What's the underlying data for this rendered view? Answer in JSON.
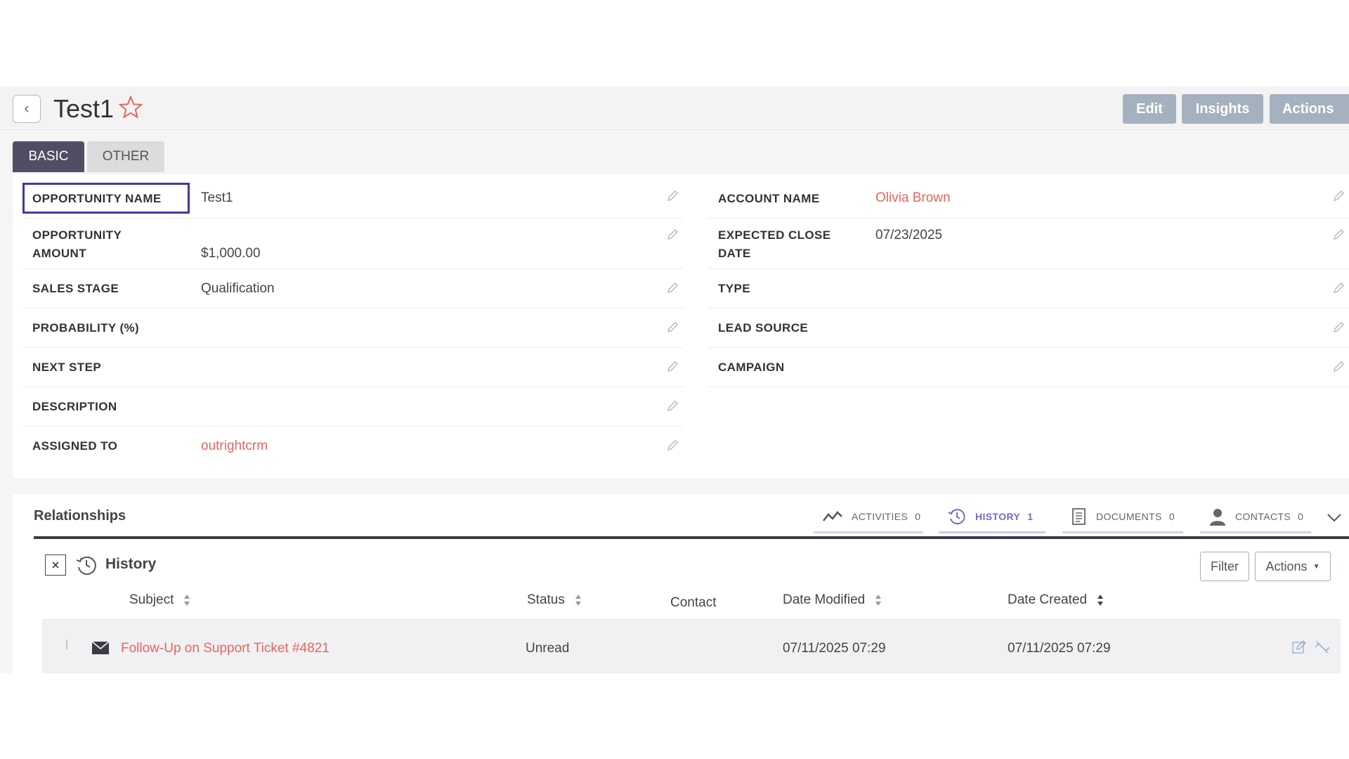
{
  "header": {
    "title": "Test1",
    "buttons": {
      "edit": "Edit",
      "insights": "Insights",
      "actions": "Actions"
    }
  },
  "tabs": [
    {
      "label": "BASIC",
      "active": true
    },
    {
      "label": "OTHER",
      "active": false
    }
  ],
  "fields_left": [
    {
      "label": "OPPORTUNITY NAME",
      "value": "Test1"
    },
    {
      "label_line1": "OPPORTUNITY",
      "label_line2": "AMOUNT",
      "value": "$1,000.00"
    },
    {
      "label": "SALES STAGE",
      "value": "Qualification"
    },
    {
      "label": "PROBABILITY (%)",
      "value": ""
    },
    {
      "label": "NEXT STEP",
      "value": ""
    },
    {
      "label": "DESCRIPTION",
      "value": ""
    },
    {
      "label": "ASSIGNED TO",
      "value": "outrightcrm"
    }
  ],
  "fields_right": [
    {
      "label": "ACCOUNT NAME",
      "value": "Olivia Brown"
    },
    {
      "label_line1": "EXPECTED CLOSE",
      "label_line2": "DATE",
      "value": "07/23/2025"
    },
    {
      "label": "TYPE",
      "value": ""
    },
    {
      "label": "LEAD SOURCE",
      "value": ""
    },
    {
      "label": "CAMPAIGN",
      "value": ""
    }
  ],
  "relationships": {
    "title": "Relationships",
    "tabs": [
      {
        "label": "ACTIVITIES",
        "count": "0",
        "icon": "activity-chart-icon"
      },
      {
        "label": "HISTORY",
        "count": "1",
        "icon": "history-clock-icon",
        "active": true
      },
      {
        "label": "DOCUMENTS",
        "count": "0",
        "icon": "document-icon"
      },
      {
        "label": "CONTACTS",
        "count": "0",
        "icon": "person-icon"
      }
    ],
    "subpanel": {
      "title": "History",
      "filter_label": "Filter",
      "actions_label": "Actions",
      "columns": [
        "Subject",
        "Status",
        "Contact",
        "Date Modified",
        "Date Created"
      ],
      "rows": [
        {
          "subject": "Follow-Up on Support Ticket #4821",
          "status": "Unread",
          "contact": "",
          "date_modified": "07/11/2025 07:29",
          "date_created": "07/11/2025 07:29"
        }
      ]
    }
  },
  "colors": {
    "accent": "#534d64",
    "link": "#e8655f",
    "header_button": "#a5b1bf",
    "focus_border": "#3c3aa6",
    "history_active": "#7c66c8"
  }
}
